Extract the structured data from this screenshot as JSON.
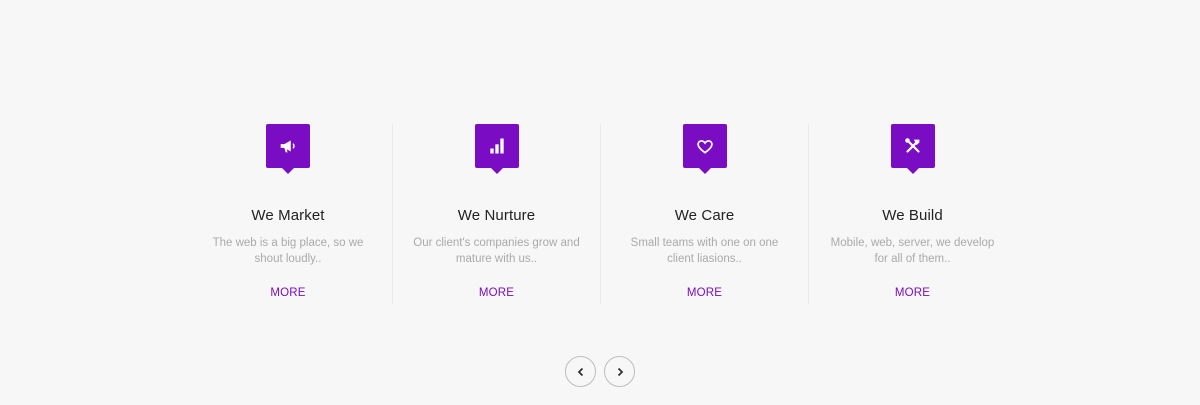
{
  "brand": {
    "accent_color": "#7a0dc4"
  },
  "services": [
    {
      "icon": "megaphone-icon",
      "title": "We Market",
      "description": "The web is a big place, so we shout loudly..",
      "more_label": "MORE"
    },
    {
      "icon": "bar-chart-icon",
      "title": "We Nurture",
      "description": "Our client's companies grow and mature with us..",
      "more_label": "MORE"
    },
    {
      "icon": "heart-icon",
      "title": "We Care",
      "description": "Small teams with one on one client liasions..",
      "more_label": "MORE"
    },
    {
      "icon": "tools-icon",
      "title": "We Build",
      "description": "Mobile, web, server, we develop for all of them..",
      "more_label": "MORE"
    }
  ],
  "carousel": {
    "prev_icon": "chevron-left-icon",
    "next_icon": "chevron-right-icon"
  }
}
